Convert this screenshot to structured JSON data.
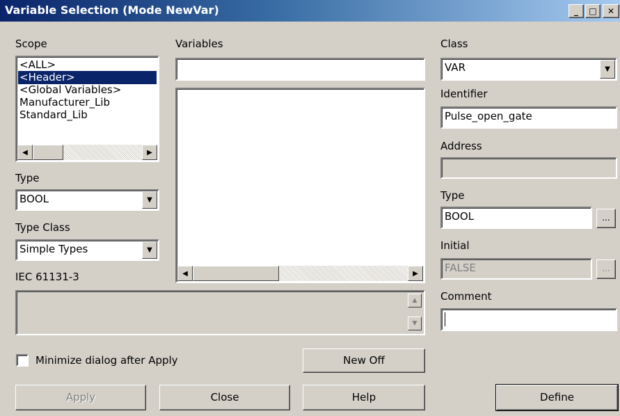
{
  "window": {
    "title": "Variable Selection (Mode NewVar)",
    "minimize_glyph": "_",
    "maximize_glyph": "□",
    "close_glyph": "✕"
  },
  "left": {
    "scope_label": "Scope",
    "scope_items": [
      "<ALL>",
      "<Header>",
      "<Global Variables>",
      "Manufacturer_Lib",
      "Standard_Lib"
    ],
    "scope_selected": "<Header>",
    "type_label": "Type",
    "type_value": "BOOL",
    "type_class_label": "Type Class",
    "type_class_value": "Simple Types",
    "standard_label": "IEC 61131-3"
  },
  "middle": {
    "variables_label": "Variables",
    "variables_filter": "",
    "variables_items": []
  },
  "right": {
    "class_label": "Class",
    "class_value": "VAR",
    "identifier_label": "Identifier",
    "identifier_value": "Pulse_open_gate",
    "address_label": "Address",
    "address_value": "",
    "type_label": "Type",
    "type_value": "BOOL",
    "initial_label": "Initial",
    "initial_value": "FALSE",
    "comment_label": "Comment",
    "comment_value": "",
    "ellipsis": "..."
  },
  "bottom": {
    "minimize_checkbox_label": "Minimize dialog after Apply",
    "minimize_checked": false,
    "new_off_label": "New Off",
    "apply_label": "Apply",
    "close_label": "Close",
    "help_label": "Help",
    "define_label": "Define"
  },
  "icons": {
    "arrow_down": "▼",
    "arrow_up": "▲",
    "arrow_left": "◀",
    "arrow_right": "▶"
  },
  "colors": {
    "titlebar_start": "#0a246a",
    "titlebar_end": "#a6caf0",
    "selection": "#0a246a",
    "dialog_bg": "#d4d0c8"
  }
}
